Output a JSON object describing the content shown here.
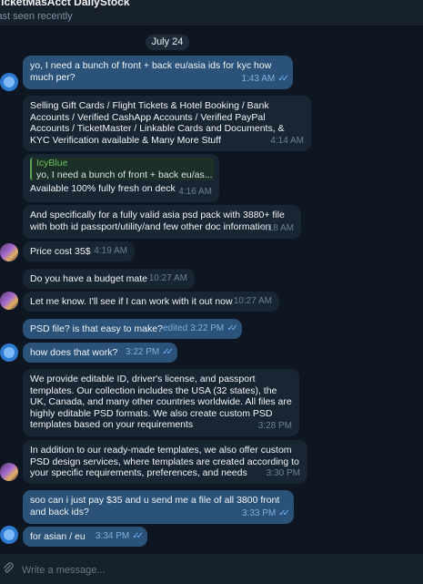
{
  "header": {
    "title": "TicketMasAcct DailyStock",
    "status": "last seen recently"
  },
  "date_separator": "July 24",
  "messages": [
    {
      "text": "yo, I need a bunch of front + back eu/asia ids for kyc how much per?",
      "time": "1:43 AM"
    },
    {
      "text": "Selling Gift Cards / Flight Tickets & Hotel Booking / Bank Accounts / Verified CashApp Accounts / Verified PayPal Accounts / TicketMaster / Linkable Cards and Documents, & KYC Verification available & Many More Stuff",
      "time": "4:14 AM"
    },
    {
      "reply_author": "IcyBlue",
      "reply_text": "yo, I need a bunch of front + back eu/as...",
      "text": "Available 100% fully fresh on deck",
      "time": "4:16 AM"
    },
    {
      "text": "And specifically for a fully valid asia psd pack with 3880+ file with both id passport/utility/and few other doc information",
      "time": "4:18 AM"
    },
    {
      "text": "Price cost 35$",
      "time": "4:19 AM"
    },
    {
      "text": "Do you have a budget mate",
      "time": "10:27 AM"
    },
    {
      "text": "Let me know. I'll see if I can work with it out now",
      "time": "10:27 AM"
    },
    {
      "text": "PSD file? is that easy to make?",
      "time": "edited 3:22 PM"
    },
    {
      "text": "how does that work?",
      "time": "3:22 PM"
    },
    {
      "text": "We provide editable ID, driver's license, and passport templates. Our collection includes the USA (32 states), the UK, Canada, and many other countries worldwide. All files are highly editable PSD formats. We also create custom PSD templates based on your requirements",
      "time": "3:28 PM"
    },
    {
      "text": "In addition to our ready-made templates, we also offer custom PSD design services, where templates are created according to your specific requirements, preferences, and needs",
      "time": "3:30 PM"
    },
    {
      "text": "soo can i just pay $35 and u send me a file of all 3800 front and back ids?",
      "time": "3:33 PM"
    },
    {
      "text": "for asian / eu",
      "time": "3:34 PM"
    }
  ],
  "input": {
    "placeholder": "Write a message..."
  },
  "colors": {
    "background": "#0e1621",
    "incoming": "#182533",
    "outgoing": "#2b5278",
    "reply_accent": "#59a84b"
  }
}
